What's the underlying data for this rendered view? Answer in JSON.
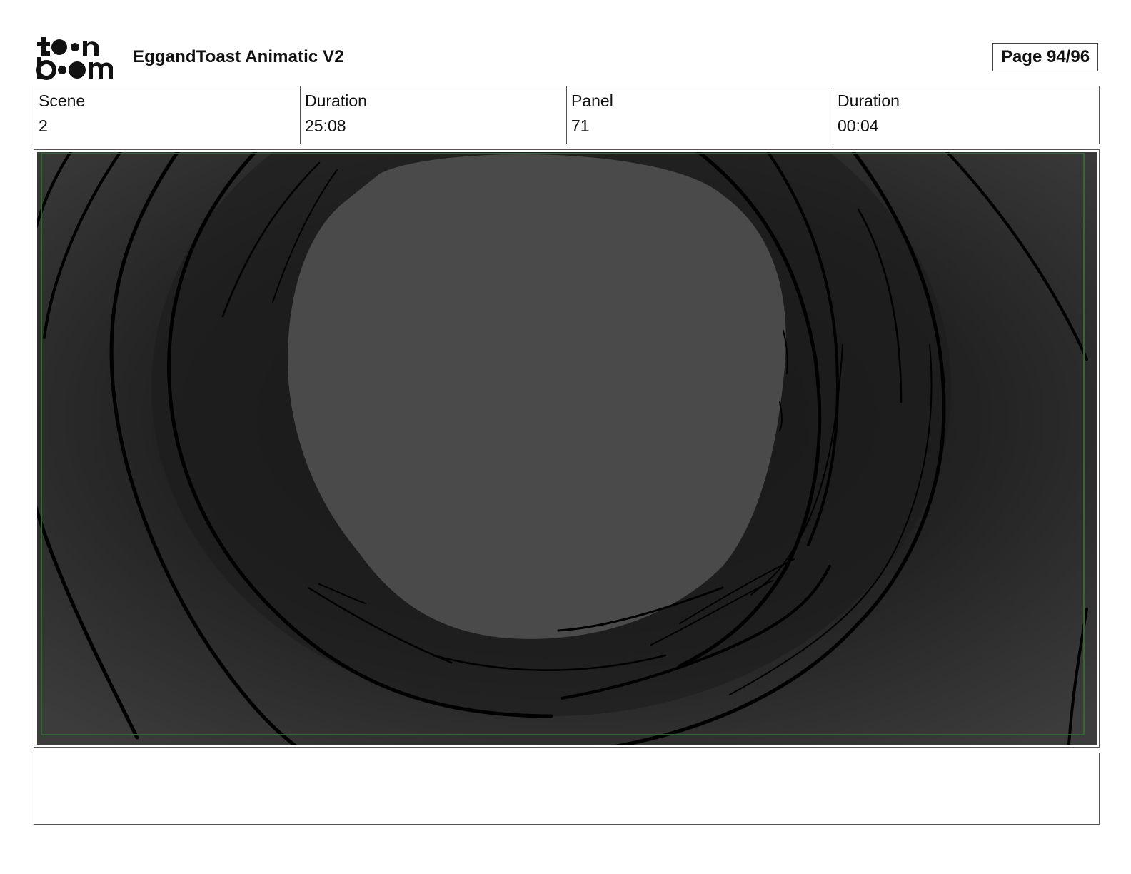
{
  "header": {
    "logo_text_top": "toon",
    "logo_text_bottom": "boom",
    "title": "EggandToast Animatic V2",
    "page_label": "Page 94/96"
  },
  "info": [
    {
      "label": "Scene",
      "value": "2"
    },
    {
      "label": "Duration",
      "value": "25:08"
    },
    {
      "label": "Panel",
      "value": "71"
    },
    {
      "label": "Duration",
      "value": "00:04"
    }
  ],
  "panel": {
    "background_color": "#2b2b2b",
    "circle_color": "#4a4a4a",
    "line_color": "#000000",
    "safe_frame_color": "#2e6b2e"
  },
  "notes": {
    "text": ""
  }
}
